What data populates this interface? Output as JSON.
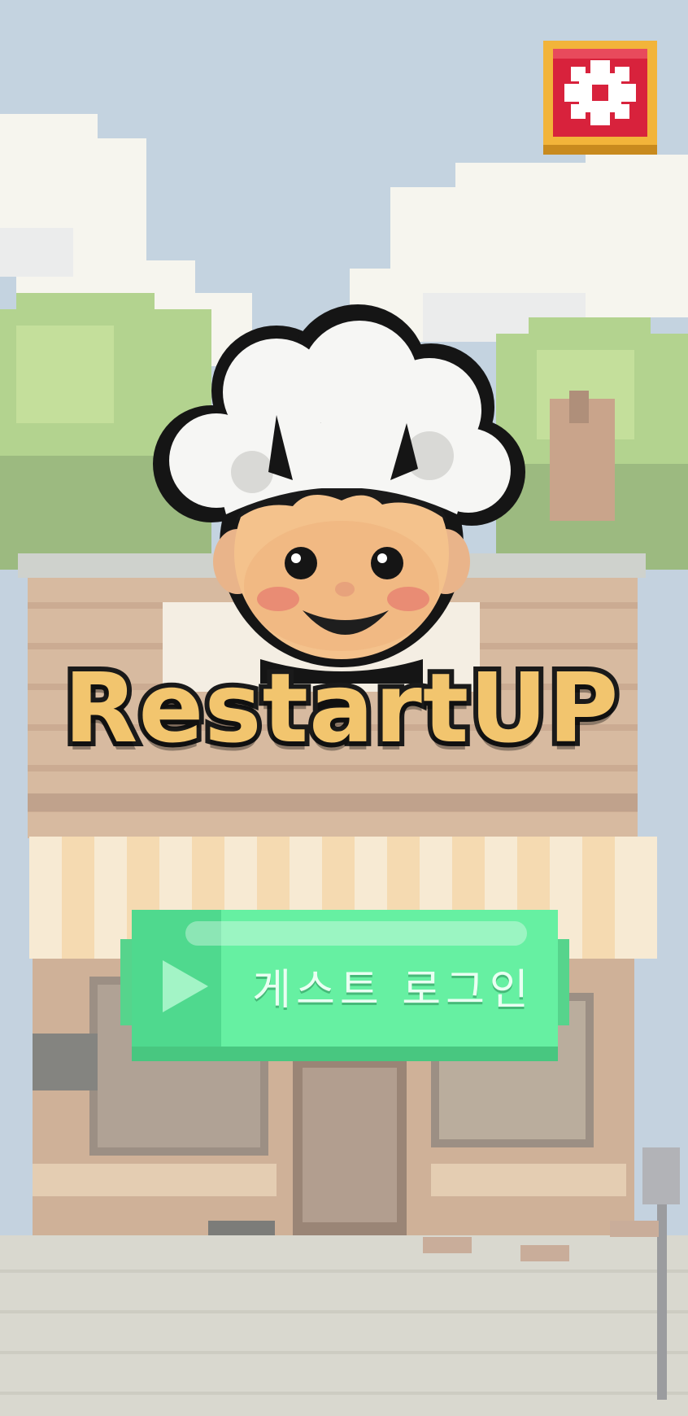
{
  "app": {
    "title": "RestartUP"
  },
  "settings": {
    "icon": "gear-icon"
  },
  "logo": {
    "icon": "chef-mascot"
  },
  "login": {
    "guest_label": "게스트 로그인",
    "guest_icon": "play-icon"
  },
  "colors": {
    "accent_green": "#66f0a2",
    "settings_red": "#d8223c",
    "settings_gold": "#f2b43a",
    "title_gold": "#f2c56e"
  }
}
